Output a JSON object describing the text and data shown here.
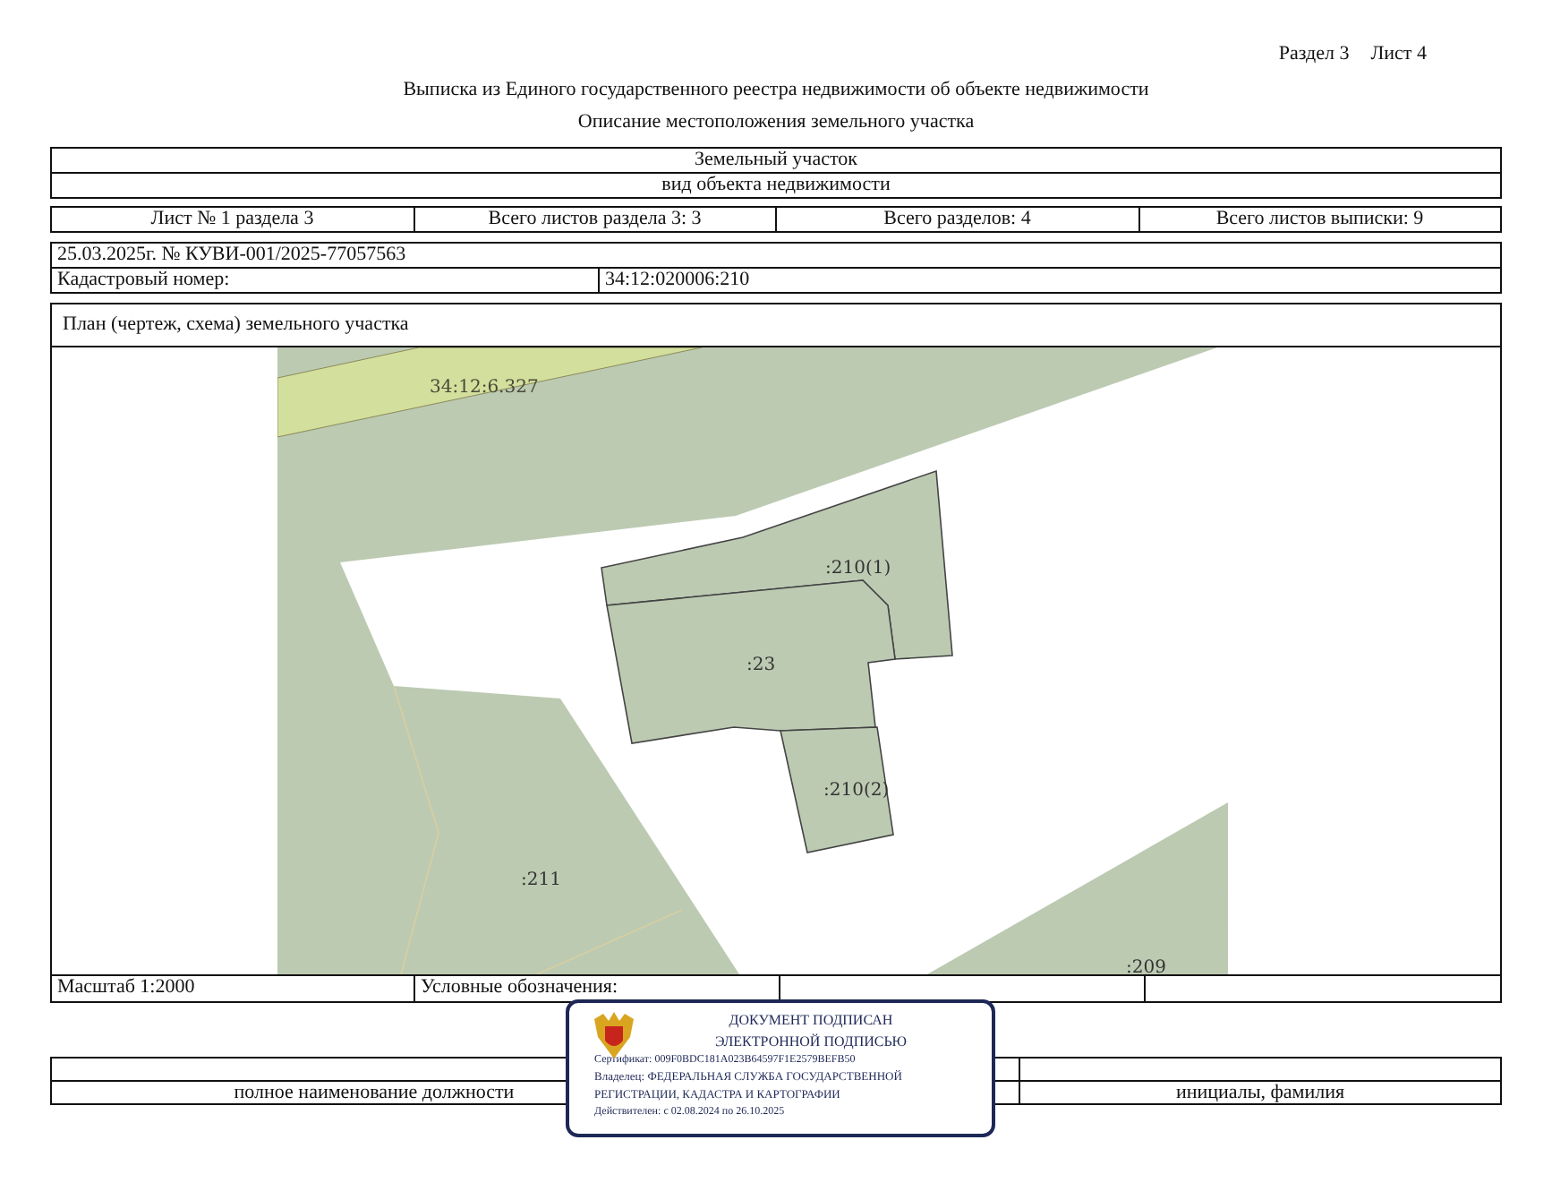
{
  "header": {
    "section": "Раздел 3",
    "sheet": "Лист 4"
  },
  "title": "Выписка из Единого государственного реестра недвижимости об объекте недвижимости",
  "subtitle": "Описание местоположения земельного участка",
  "object": {
    "name": "Земельный участок",
    "caption": "вид объекта недвижимости"
  },
  "sheet_info": [
    "Лист № 1 раздела 3",
    "Всего листов раздела 3: 3",
    "Всего разделов: 4",
    "Всего листов выписки: 9"
  ],
  "document": {
    "number": "25.03.2025г. № КУВИ-001/2025-77057563",
    "cadastral_label": "Кадастровый номер:",
    "cadastral_number": "34:12:020006:210"
  },
  "plan": {
    "title": "План (чертеж, схема) земельного участка",
    "map_labels": [
      "34:12:6.327",
      ":210(1)",
      ":23",
      ":210(2)",
      ":211",
      ":209"
    ],
    "scale": "Масштаб 1:2000",
    "legend_label": "Условные обозначения:"
  },
  "signature": {
    "position_caption": "полное наименование должности",
    "name_caption": "инициалы, фамилия"
  },
  "stamp": {
    "lines": [
      "ДОКУМЕНТ ПОДПИСАН",
      "ЭЛЕКТРОННОЙ ПОДПИСЬЮ"
    ],
    "certificate": "Сертификат: 009F0BDC181A023B64597F1E2579BEFB50",
    "owner": "Владелец: ФЕДЕРАЛЬНАЯ СЛУЖБА ГОСУДАРСТВЕННОЙ РЕГИСТРАЦИИ, КАДАСТРА И КАРТОГРАФИИ",
    "validity": "Действителен: с 02.08.2024 по 26.10.2025"
  }
}
